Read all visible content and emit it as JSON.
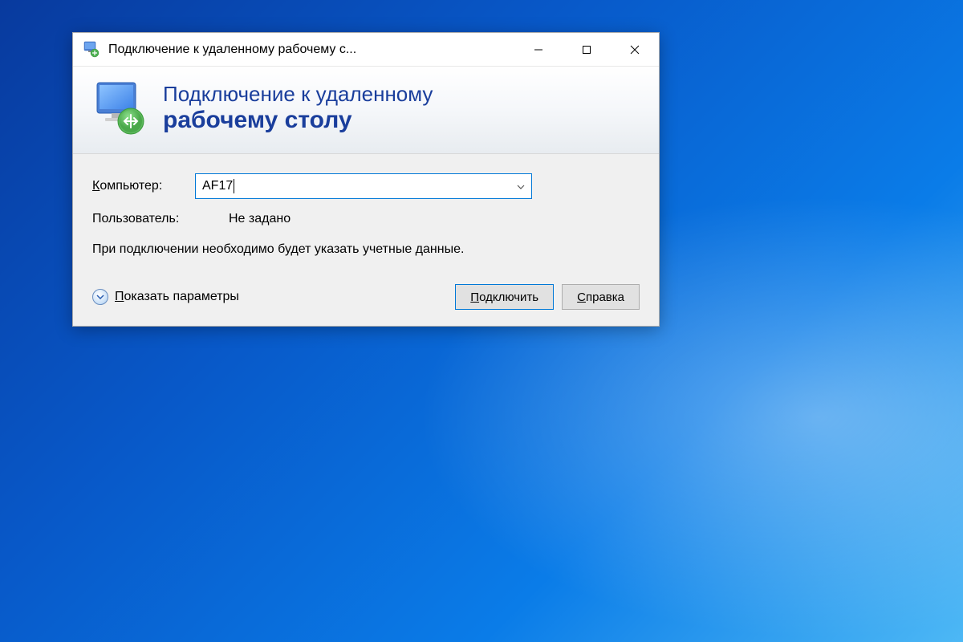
{
  "titlebar": {
    "text": "Подключение к удаленному рабочему с..."
  },
  "header": {
    "line1": "Подключение к удаленному",
    "line2": "рабочему столу"
  },
  "form": {
    "computer_label_prefix": "К",
    "computer_label_rest": "омпьютер:",
    "computer_value": "AF17",
    "user_label": "Пользователь:",
    "user_value": "Не задано",
    "hint": "При подключении необходимо будет указать учетные данные."
  },
  "buttons": {
    "show_options_prefix": "П",
    "show_options_rest": "оказать параметры",
    "connect_prefix": "П",
    "connect_rest": "одключить",
    "help_prefix": "С",
    "help_rest": "правка"
  }
}
